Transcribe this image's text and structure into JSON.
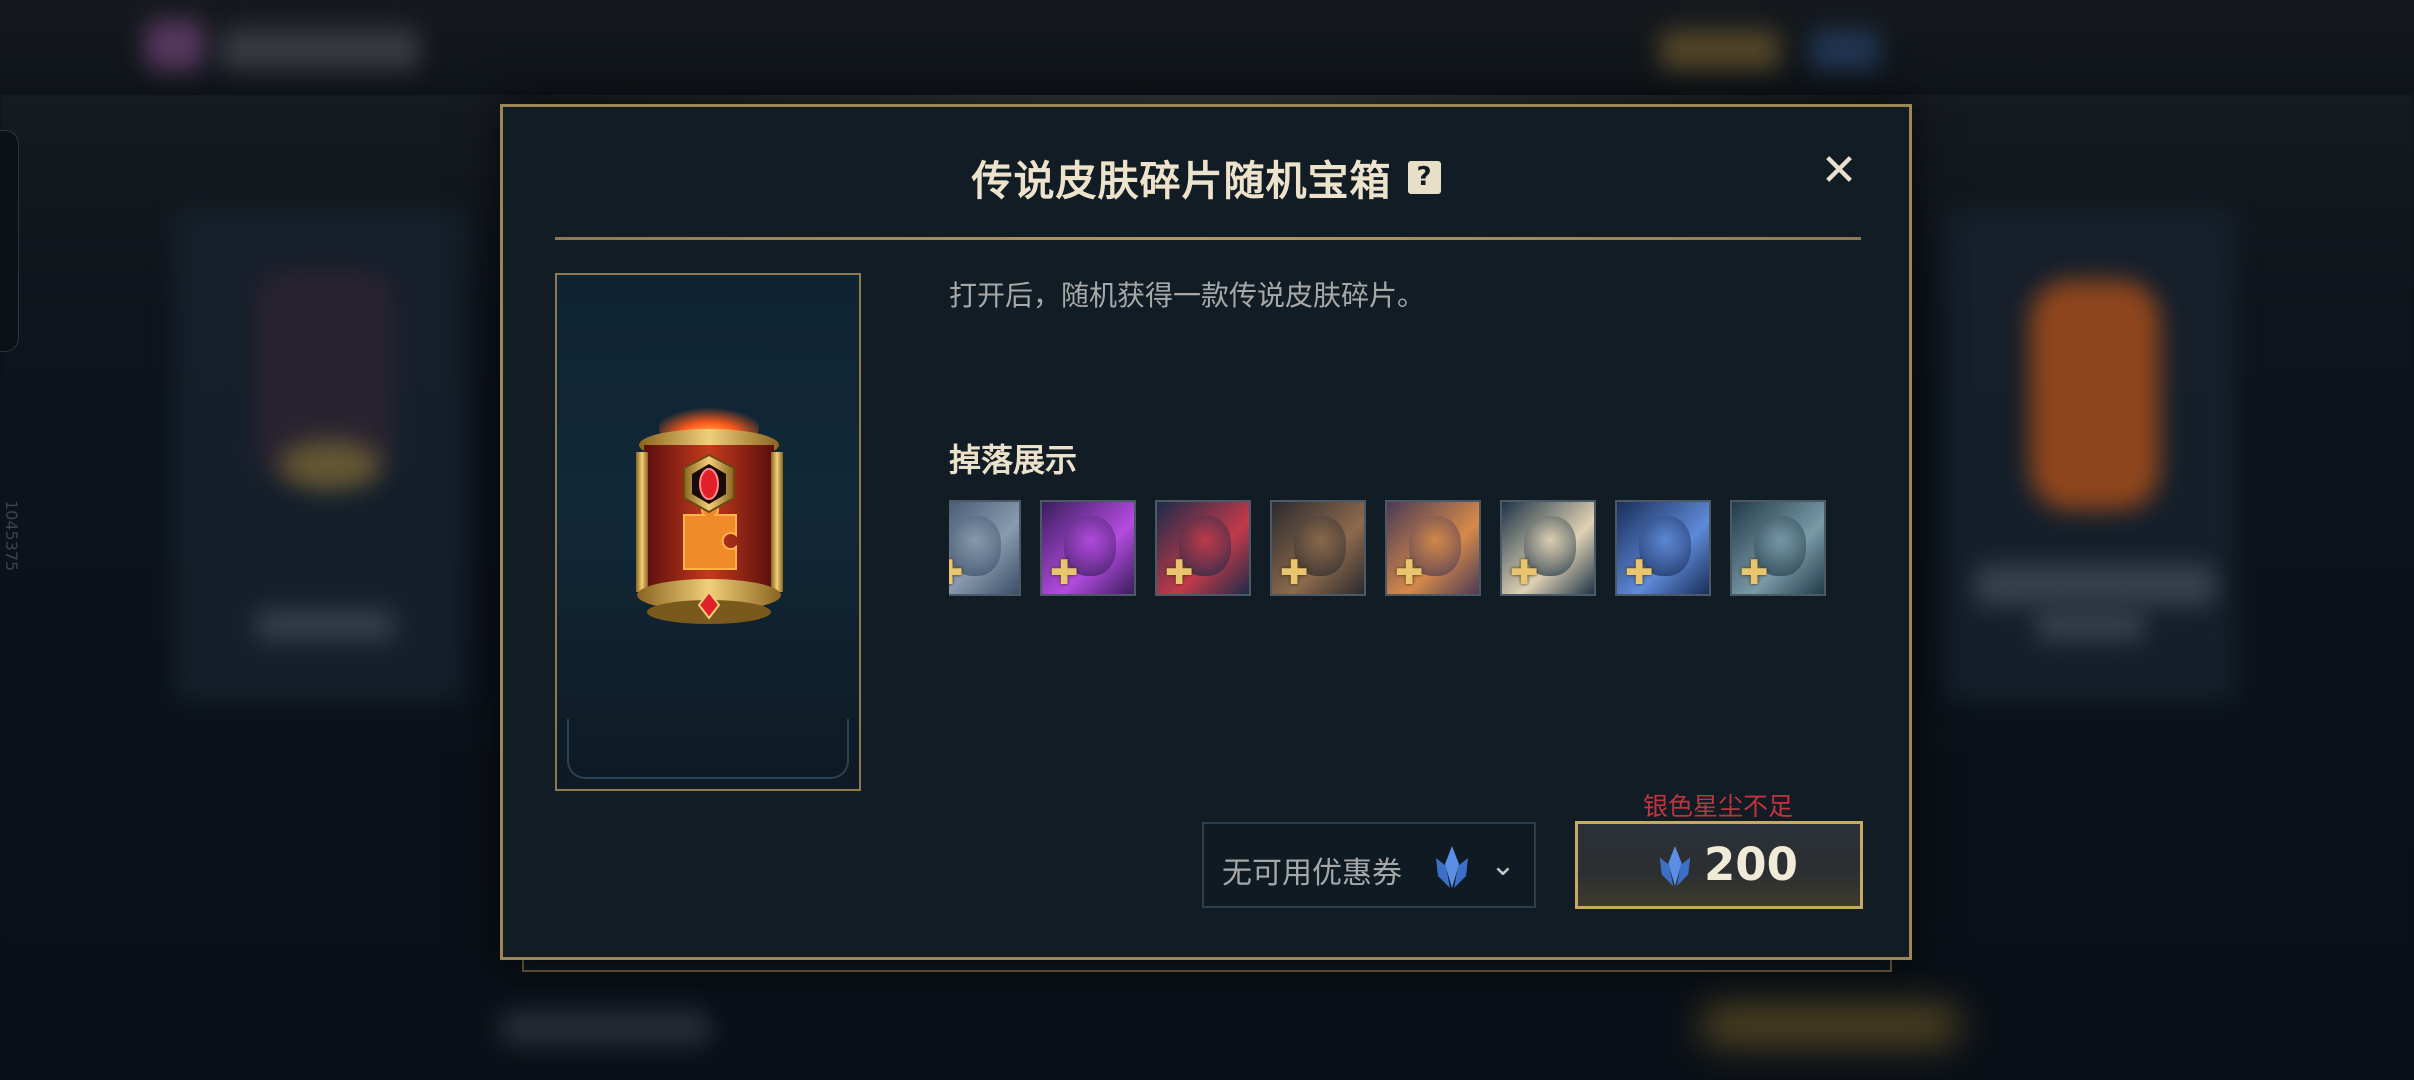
{
  "dialog": {
    "title": "传说皮肤碎片随机宝箱",
    "help_glyph": "?",
    "close_glyph": "✕",
    "description": "打开后，随机获得一款传说皮肤碎片。",
    "drops_title": "掉落展示",
    "drops": [
      {
        "name": "drop-1",
        "colors": [
          "#3b4e66",
          "#8a9bb0"
        ]
      },
      {
        "name": "drop-2",
        "colors": [
          "#3a1e5c",
          "#b44be0"
        ]
      },
      {
        "name": "drop-3",
        "colors": [
          "#1d2b4a",
          "#c23a4a"
        ]
      },
      {
        "name": "drop-4",
        "colors": [
          "#2b2a2e",
          "#8c6a4c"
        ]
      },
      {
        "name": "drop-5",
        "colors": [
          "#4a3a56",
          "#d68a4a"
        ]
      },
      {
        "name": "drop-6",
        "colors": [
          "#1e3448",
          "#e0d2b4"
        ]
      },
      {
        "name": "drop-7",
        "colors": [
          "#1a2e5a",
          "#5e8ad8"
        ]
      },
      {
        "name": "drop-8",
        "colors": [
          "#223a4a",
          "#7a9aa8"
        ]
      }
    ],
    "coupon_label": "无可用优惠券",
    "coupon_chevron": "⌄",
    "warning_text": "银色星尘不足",
    "price": "200",
    "accent_color": "#9c8655",
    "warning_color": "#c1343f",
    "currency_icon": "silver-stardust-icon"
  },
  "background": {
    "side_id": "1045375"
  }
}
